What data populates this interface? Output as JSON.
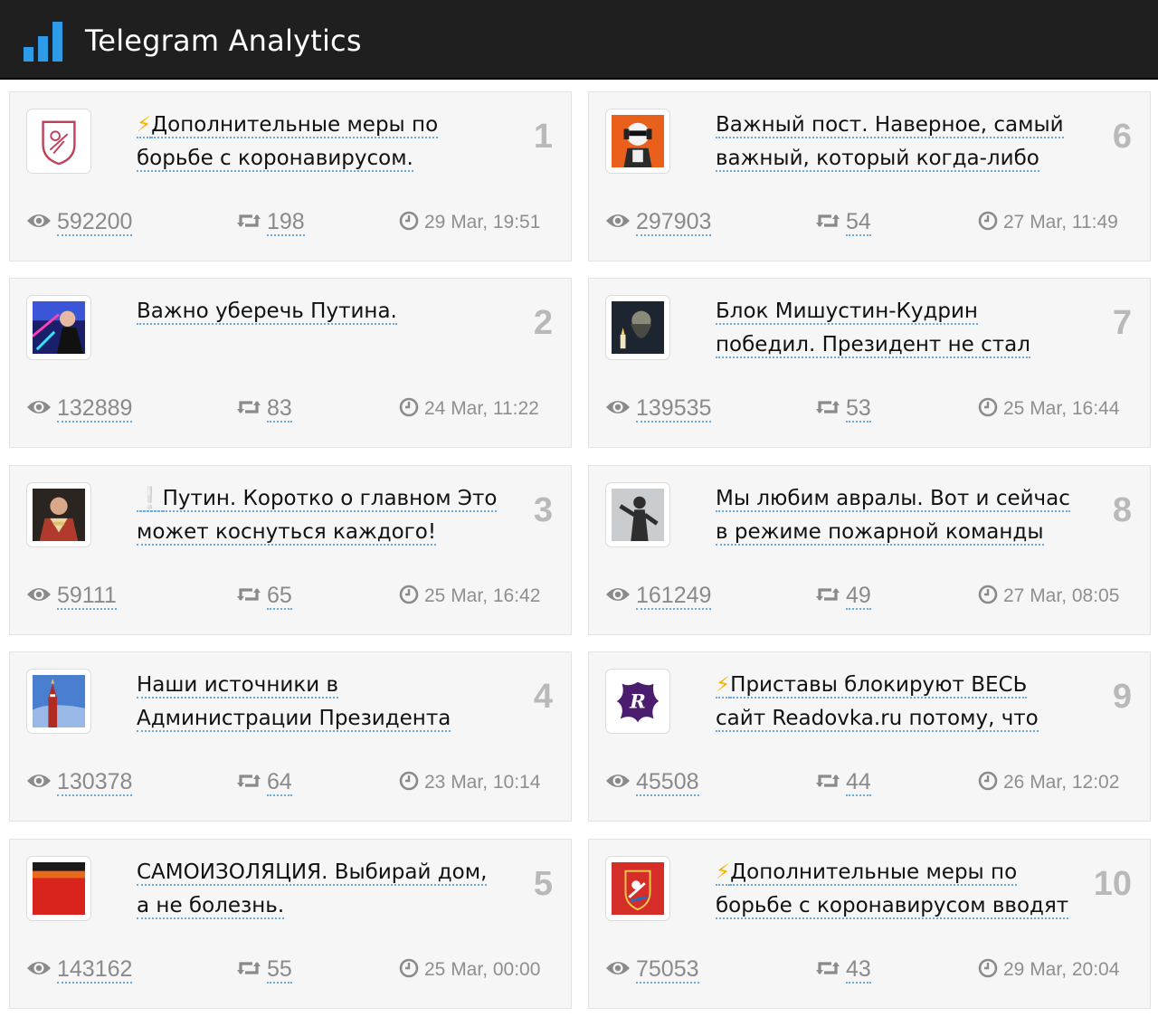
{
  "app": {
    "title": "Telegram Analytics"
  },
  "posts": [
    {
      "rank": "1",
      "prefix": "⚡",
      "prefix_kind": "bolt",
      "title": "Дополнительные меры по борьбе с коронавирусом.",
      "views": "592200",
      "shares": "198",
      "date": "29 Mar, 19:51",
      "avatar_icon": "moscow-emblem-avatar"
    },
    {
      "rank": "2",
      "prefix": "",
      "prefix_kind": "",
      "title": "Важно уберечь Путина.",
      "views": "132889",
      "shares": "83",
      "date": "24 Mar, 11:22",
      "avatar_icon": "singer-avatar"
    },
    {
      "rank": "3",
      "prefix": "❕",
      "prefix_kind": "excl",
      "title": "Путин. Коротко о главном Это может коснуться каждого!",
      "views": "59111",
      "shares": "65",
      "date": "25 Mar, 16:42",
      "avatar_icon": "officer-portrait-avatar"
    },
    {
      "rank": "4",
      "prefix": "",
      "prefix_kind": "",
      "title": "Наши источники в Администрации Президента",
      "views": "130378",
      "shares": "64",
      "date": "23 Mar, 10:14",
      "avatar_icon": "kremlin-tower-avatar"
    },
    {
      "rank": "5",
      "prefix": "",
      "prefix_kind": "",
      "title": "САМОИЗОЛЯЦИЯ. Выбирай дом, а не болезнь.",
      "views": "143162",
      "shares": "55",
      "date": "25 Mar, 00:00",
      "avatar_icon": "red-painting-avatar"
    },
    {
      "rank": "6",
      "prefix": "",
      "prefix_kind": "",
      "title": "Важный пост. Наверное, самый важный, который когда-либо",
      "views": "297903",
      "shares": "54",
      "date": "27 Mar, 11:49",
      "avatar_icon": "stormtrooper-avatar"
    },
    {
      "rank": "7",
      "prefix": "",
      "prefix_kind": "",
      "title": "Блок Мишустин-Кудрин победил. Президент не стал",
      "views": "139535",
      "shares": "53",
      "date": "25 Mar, 16:44",
      "avatar_icon": "bearded-man-avatar"
    },
    {
      "rank": "8",
      "prefix": "",
      "prefix_kind": "",
      "title": "Мы любим авралы. Вот и сейчас в режиме пожарной команды",
      "views": "161249",
      "shares": "49",
      "date": "27 Mar, 08:05",
      "avatar_icon": "statue-avatar"
    },
    {
      "rank": "9",
      "prefix": "⚡",
      "prefix_kind": "bolt",
      "title": "Приставы блокируют ВЕСЬ сайт Readovka.ru потому, что",
      "views": "45508",
      "shares": "44",
      "date": "26 Mar, 12:02",
      "avatar_icon": "readovka-logo-avatar"
    },
    {
      "rank": "10",
      "prefix": "⚡",
      "prefix_kind": "bolt",
      "title": "Дополнительные меры по борьбе с коронавирусом вводят в",
      "views": "75053",
      "shares": "43",
      "date": "29 Mar, 20:04",
      "avatar_icon": "moscow-region-emblem-avatar"
    }
  ]
}
